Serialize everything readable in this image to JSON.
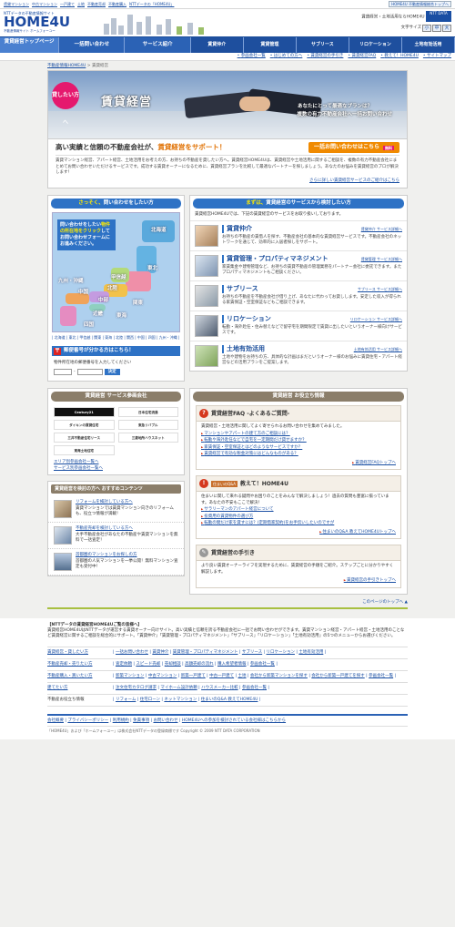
{
  "topbar": {
    "links": [
      "賃貸マンション",
      "中古マンション",
      "一戸建て",
      "土地",
      "不動産売却",
      "不動産購入",
      "NTTデータの「HOME4U」"
    ],
    "badge": "HOME4U 不動産情報総合トップへ"
  },
  "header": {
    "logo_small": "NTTデータの不動産情報サイト",
    "logo": "HOME4U",
    "logo_sub": "不動産情報サイト ホームフォーユー",
    "site_title": "賃貸経営・土地活用ならHOME4U",
    "ntt": "NTT DATA",
    "fontsize_label": "文字サイズ",
    "fontsize": [
      "小",
      "中",
      "大"
    ]
  },
  "mainnav": {
    "top": "賃貸経営トップページ",
    "items": [
      "一括問い合わせ",
      "サービス紹介",
      "賃貸仲介",
      "賃貸管理",
      "サブリース",
      "リロケーション",
      "土地有効活用"
    ]
  },
  "subnav": [
    "参画会社一覧",
    "はじめての方へ",
    "賃貸経営の手引き",
    "賃貸経営FAQ",
    "教えて！HOME4U",
    "サイトマップ"
  ],
  "breadcrumb": {
    "home": "不動産情報HOME4U",
    "current": "賃貸経営"
  },
  "hero": {
    "badge": "貸したい方へ",
    "title": "賃貸経営",
    "tag1": "あなたにとって最適なプランは？",
    "tag2": "複数の有力不動産会社へ一括お問い合わせ"
  },
  "intro": {
    "heading_pre": "高い実績と信頼の不動産会社が、",
    "heading_em": "賃貸経営をサポート！",
    "cta": "一括お問い合わせはこちら",
    "cta_badge": "無料",
    "body": "賃貸マンション経営、アパート経営、土地活用をお考えの方、お持ちの不動産を貸したい方へ。賃貸経営HOME4Uは、賃貸経営や土地活用に関するご相談を、複数の有力不動産会社にまとめてお問い合わせいただけるサービスです。成功する賃貸オーナーになるために、賃貸経営プランを比較して最適なパートナーを探しましょう。あなたのお悩みを賃貸経営のプロが解決します！",
    "more": "さらに詳しい賃貸経営サービスのご紹介はこちら"
  },
  "area": {
    "heading_pre": "さっそく、",
    "heading_em": "問い合わせをしたい方",
    "note_1": "問い合わせをしたい",
    "note_em": "物件の所在地をクリック",
    "note_2": "してお問い合わせフォームにお進みください。",
    "regions": [
      "北海道",
      "東北",
      "関東",
      "甲信越",
      "北陸",
      "中部",
      "東海",
      "近畿",
      "中国",
      "四国",
      "九州・沖縄"
    ],
    "links": "| 北海道 | 東北 | 甲信越 | 関東 | 東海 | 北陸 | 関西 | 中国 | 四国 | 九州・沖縄 |"
  },
  "zip": {
    "heading": "郵便番号が分かる方はこちら！",
    "label": "物件所在地の郵便番号を入力してください",
    "sep": "-",
    "button": "決定"
  },
  "services": {
    "heading_pre": "まずは、",
    "heading_em": "賃貸経営のサービスから検討したい方",
    "intro": "賃貸経営HOME4Uでは、下記の賃貸経営のサービスをお取り扱いしております。",
    "items": [
      {
        "name": "賃貸仲介",
        "link": "賃貸仲介 サービス詳細へ",
        "desc": "お持ちの不動産の賃借人を探す、不動産会社の基本的な賃貸経営サービスです。不動産会社のネットワークを通じて、効率的に入居者探しをサポート。"
      },
      {
        "name": "賃貸管理・プロパティマネジメント",
        "link": "賃貸管理 サービス詳細へ",
        "desc": "家賃集金や建物管理など、お持ちの賃貸不動産の管理業務をパートナー会社に委託できます。またプロパティマネジメントもご相談ください。"
      },
      {
        "name": "サブリース",
        "link": "サブリース サービス詳細へ",
        "desc": "お持ちの不動産を不動産会社が借り上げ、あなたに代わってお貸しします。安定した収入が得られる家賃保証・空室保証などもご相談できます。"
      },
      {
        "name": "リロケーション",
        "link": "リロケーション サービス詳細へ",
        "desc": "転勤・海外赴任・住み替えなどで留守宅を期間限定で賃貸に出したいというオーナー様向けサービスです。"
      },
      {
        "name": "土地有効活用",
        "link": "土地有効活用 サービス詳細へ",
        "desc": "土地や建物をお持ちの方、具体的な計画はまだというオーナー様のお悩みに賃貸住宅・アパート経営などの活用プランをご提案します。"
      }
    ]
  },
  "members": {
    "heading": "賃貸経営 サービス参画会社",
    "logos": [
      "Century21",
      "日本住宅流通",
      "ダイキンの賃貸住宅",
      "東急リバブル",
      "三井不動産住宅リース",
      "三菱地所ハウスネット",
      "東海土地住宅"
    ],
    "links": [
      "エリア別参画会社一覧へ",
      "サービス別参画会社一覧へ"
    ]
  },
  "content": {
    "heading": "賃貸経営を検討の方へ おすすめコンテンツ",
    "items": [
      {
        "title": "リフォームを検討している方へ",
        "desc": "賃貸マンションでは賃貸マンション向きのリフォームも、役立つ情報が満載！"
      },
      {
        "title": "不動産売却を検討している方へ",
        "desc": "大手不動産会社があなたの不動産や賃貸マンションを無料で一括査定！"
      },
      {
        "title": "首都圏のマンションをお探しの方",
        "desc": "首都圏の人気マンションを一挙公開！無料マンション査定も受付中！"
      }
    ]
  },
  "info": {
    "heading": "賃貸経営 お役立ち情報",
    "faq": {
      "title": "賃貸経営FAQ -よくあるご質問-",
      "lead": "賃貸経営・土地活用に関してよく寄せられるお問い合わせを集めてみました。",
      "items": [
        "マンションやアパートの建て方のご相談には？",
        "転勤や海外赴任などで自宅を一定期間だけ貸せますか？",
        "家賃保証・空室保証とはどのようなサービスですか？",
        "賃貸経営で有効な税金対策にはどんなものがある？"
      ],
      "more": "賃貸経営FAQトップへ"
    },
    "qa": {
      "chip": "住まいのQ&A",
      "title": "教えて！HOME4U",
      "lead": "住まいに関して来れる疑問やお困りのことをみんなで解決しましょう！過去の質問も豊富に揃っています。あなたの不安もここで解決！",
      "items": [
        "サラリーマンのアパート経営について",
        "投資用の賃貸物件の選び方",
        "転勤の間だけ家を貸すには？(定期借家契約)をお手伝いしたいのですが"
      ],
      "more": "住まいのQ&A 教えてHOME4Uトップへ"
    },
    "guide": {
      "title": "賃貸経営の手引き",
      "lead": "より良い賃貸オーナーライフを実現するために、賃貸経営の手順をご紹介。ステップごとに分かりやすく解説します。",
      "more": "賃貸経営の手引きトップへ"
    }
  },
  "pagetop": "このページのトップへ",
  "footer": {
    "about_title": "【NTTデータの賃貸経営HOME4Uご覧の皆様へ】",
    "about": "賃貸経営HOME4UはNTTデータが運営する賃貸オーナー向けサイト。高い実績と信頼を誇る不動産会社に一括でお問い合わせができます。賃貸マンション経営・アパート経営・土地活用のことなど賃貸経営に関するご相談を総合的にサポート。「賃貸仲介」「賃貸管理・プロパティマネジメント」「サブリース」「リロケーション」「土地有効活用」の5つのメニューからお選びください。",
    "rows": [
      {
        "k": "賃貸経営・貸したい方",
        "v": [
          "一括お問い合わせ",
          "賃貸仲介",
          "賃貸管理・プロパティマネジメント",
          "サブリース",
          "リロケーション",
          "土地有効活用"
        ]
      },
      {
        "k": "不動産売却・売りたい方",
        "v": [
          "査定依頼",
          "スピード売却",
          "売却相談",
          "高額売却の流れ",
          "購入希望者情報",
          "参画会社一覧"
        ]
      },
      {
        "k": "不動産購入・買いたい方",
        "v": [
          "新築マンション",
          "中古マンション",
          "新築一戸建て",
          "中古一戸建て",
          "土地",
          "会社から新築マンションを探す",
          "会社から新築一戸建てを探す",
          "参画会社一覧"
        ]
      },
      {
        "k": "建てたい方",
        "v": [
          "注文住宅カタログ請求",
          "マイホーム設計依頼",
          "ハウスメーカー比較",
          "参画会社一覧"
        ]
      },
      {
        "k": "不動産お役立ち情報",
        "v": [
          "リフォーム",
          "住宅ローン",
          "ネットマンション",
          "住まいのQ&A 教えてHOME4U"
        ]
      }
    ],
    "links": [
      "会社概要",
      "プライバシーポリシー",
      "利用規約",
      "免責事項",
      "お問い合わせ",
      "HOME4Uへの参加を検討されている会社様はこちらから"
    ],
    "copyright": "「HOME4U」および「ホームフォーユー」は株式会社NTTデータの登録商標です  Copyright © 2009 NTT DATA CORPORATION"
  },
  "colors": {
    "brand_blue": "#2b62b5",
    "accent_orange": "#f08a00",
    "accent_pink": "#e5196e",
    "section_brown": "#8b7e6a"
  }
}
